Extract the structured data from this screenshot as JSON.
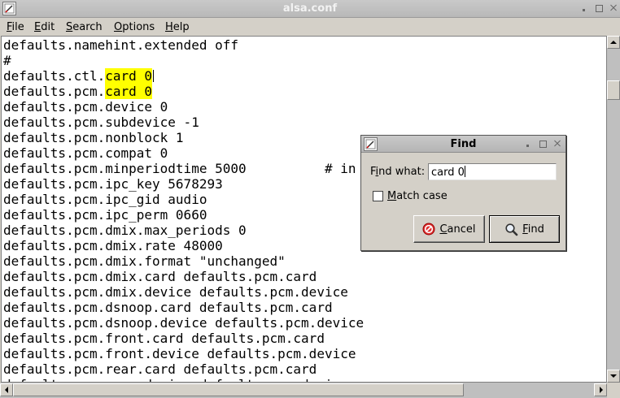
{
  "window": {
    "title": "alsa.conf"
  },
  "menu": [
    {
      "pre": "",
      "key": "F",
      "post": "ile"
    },
    {
      "pre": "",
      "key": "E",
      "post": "dit"
    },
    {
      "pre": "",
      "key": "S",
      "post": "earch"
    },
    {
      "pre": "",
      "key": "O",
      "post": "ptions"
    },
    {
      "pre": "",
      "key": "H",
      "post": "elp"
    }
  ],
  "editor": {
    "lines": [
      "defaults.namehint.extended off",
      "#",
      {
        "pre": "defaults.ctl.",
        "match": "card 0",
        "post": "",
        "caret": true
      },
      {
        "pre": "defaults.pcm.",
        "match": "card 0",
        "post": ""
      },
      "defaults.pcm.device 0",
      "defaults.pcm.subdevice -1",
      "defaults.pcm.nonblock 1",
      "defaults.pcm.compat 0",
      "defaults.pcm.minperiodtime 5000          # in",
      "defaults.pcm.ipc_key 5678293",
      "defaults.pcm.ipc_gid audio",
      "defaults.pcm.ipc_perm 0660",
      "defaults.pcm.dmix.max_periods 0",
      "defaults.pcm.dmix.rate 48000",
      "defaults.pcm.dmix.format \"unchanged\"",
      "defaults.pcm.dmix.card defaults.pcm.card",
      "defaults.pcm.dmix.device defaults.pcm.device",
      "defaults.pcm.dsnoop.card defaults.pcm.card",
      "defaults.pcm.dsnoop.device defaults.pcm.device",
      "defaults.pcm.front.card defaults.pcm.card",
      "defaults.pcm.front.device defaults.pcm.device",
      "defaults.pcm.rear.card defaults.pcm.card",
      "defaults.pcm.rear.device defaults.pcm.device"
    ],
    "highlight_color": "#ffff00"
  },
  "find_dialog": {
    "title": "Find",
    "find_label_pre": "F",
    "find_label_key": "i",
    "find_label_post": "nd what:",
    "find_value": "card 0",
    "match_case_key": "M",
    "match_case_post": "atch case",
    "match_case_checked": false,
    "cancel_key": "C",
    "cancel_post": "ancel",
    "find_btn_key": "F",
    "find_btn_post": "ind",
    "icons": {
      "cancel": "no-entry-icon",
      "find": "magnifier-icon"
    }
  }
}
